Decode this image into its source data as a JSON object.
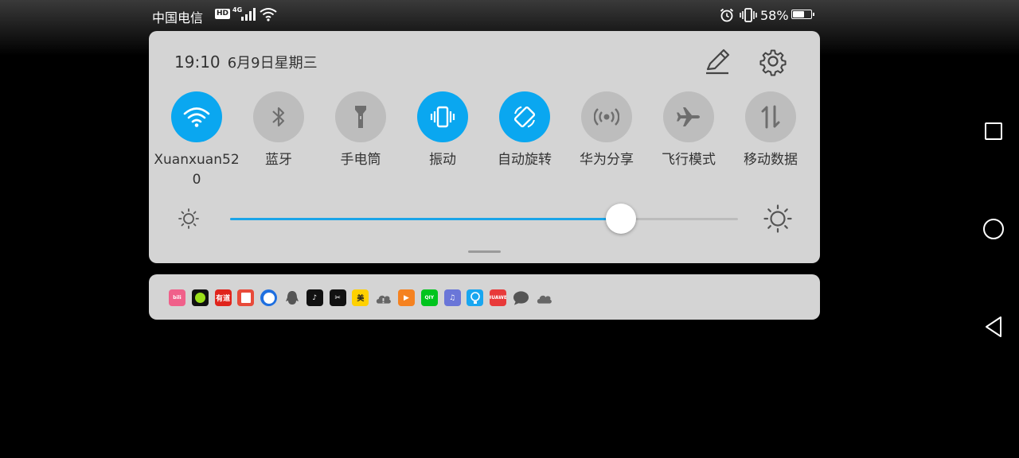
{
  "status_bar": {
    "carrier": "中国电信",
    "hd_badge": "HD",
    "network_type": "4G",
    "battery_percent": "58%",
    "battery_level": 0.58,
    "icons": [
      "hd-icon",
      "signal-icon",
      "wifi-icon",
      "alarm-icon",
      "vibrate-icon",
      "battery-icon"
    ]
  },
  "panel": {
    "time": "19:10",
    "date": "6月9日星期三",
    "edit_icon": "pencil-icon",
    "settings_icon": "gear-icon",
    "tiles": [
      {
        "label": "Xuanxuan520",
        "icon": "wifi-icon",
        "active": true
      },
      {
        "label": "蓝牙",
        "icon": "bluetooth-icon",
        "active": false
      },
      {
        "label": "手电筒",
        "icon": "flashlight-icon",
        "active": false
      },
      {
        "label": "振动",
        "icon": "vibrate-icon",
        "active": true
      },
      {
        "label": "自动旋转",
        "icon": "auto-rotate-icon",
        "active": true
      },
      {
        "label": "华为分享",
        "icon": "huawei-share-icon",
        "active": false
      },
      {
        "label": "飞行模式",
        "icon": "airplane-icon",
        "active": false
      },
      {
        "label": "移动数据",
        "icon": "mobile-data-icon",
        "active": false
      }
    ],
    "brightness": 0.77,
    "colors": {
      "active": "#0aa7f0",
      "inactive": "#bdbdbd",
      "panel": "#d4d4d4"
    }
  },
  "notification_icons": [
    {
      "name": "bilibili-icon",
      "text": "bili",
      "bg": "#f0608a"
    },
    {
      "name": "green-dot-app-icon",
      "text": "",
      "bg": "#111111"
    },
    {
      "name": "youdao-icon",
      "text": "有道",
      "bg": "#e0241c"
    },
    {
      "name": "reader-app-icon",
      "text": "",
      "bg": "#e84a3a"
    },
    {
      "name": "browser-icon",
      "text": "",
      "bg": "#1e6fe0"
    },
    {
      "name": "qq-icon",
      "text": "",
      "bg": "#d4d4d4"
    },
    {
      "name": "tiktok-icon",
      "text": "♪",
      "bg": "#111111"
    },
    {
      "name": "capcut-icon",
      "text": "✂",
      "bg": "#111111"
    },
    {
      "name": "meituan-icon",
      "text": "美",
      "bg": "#ffd100"
    },
    {
      "name": "cloud-alert-icon",
      "text": "",
      "bg": "#d4d4d4"
    },
    {
      "name": "video-app-icon",
      "text": "▶",
      "bg": "#f58220"
    },
    {
      "name": "iqiyi-icon",
      "text": "QIY",
      "bg": "#00c41e"
    },
    {
      "name": "music-icon",
      "text": "♫",
      "bg": "#6a76d8"
    },
    {
      "name": "tips-icon",
      "text": "",
      "bg": "#18a6f0"
    },
    {
      "name": "huawei-store-icon",
      "text": "HUAWEI",
      "bg": "#e83a3a"
    },
    {
      "name": "chat-bubble-icon",
      "text": "",
      "bg": "#d4d4d4"
    },
    {
      "name": "cloud-icon",
      "text": "",
      "bg": "#d4d4d4"
    }
  ],
  "nav": {
    "icons": [
      "recent-apps-icon",
      "home-icon",
      "back-icon"
    ]
  }
}
